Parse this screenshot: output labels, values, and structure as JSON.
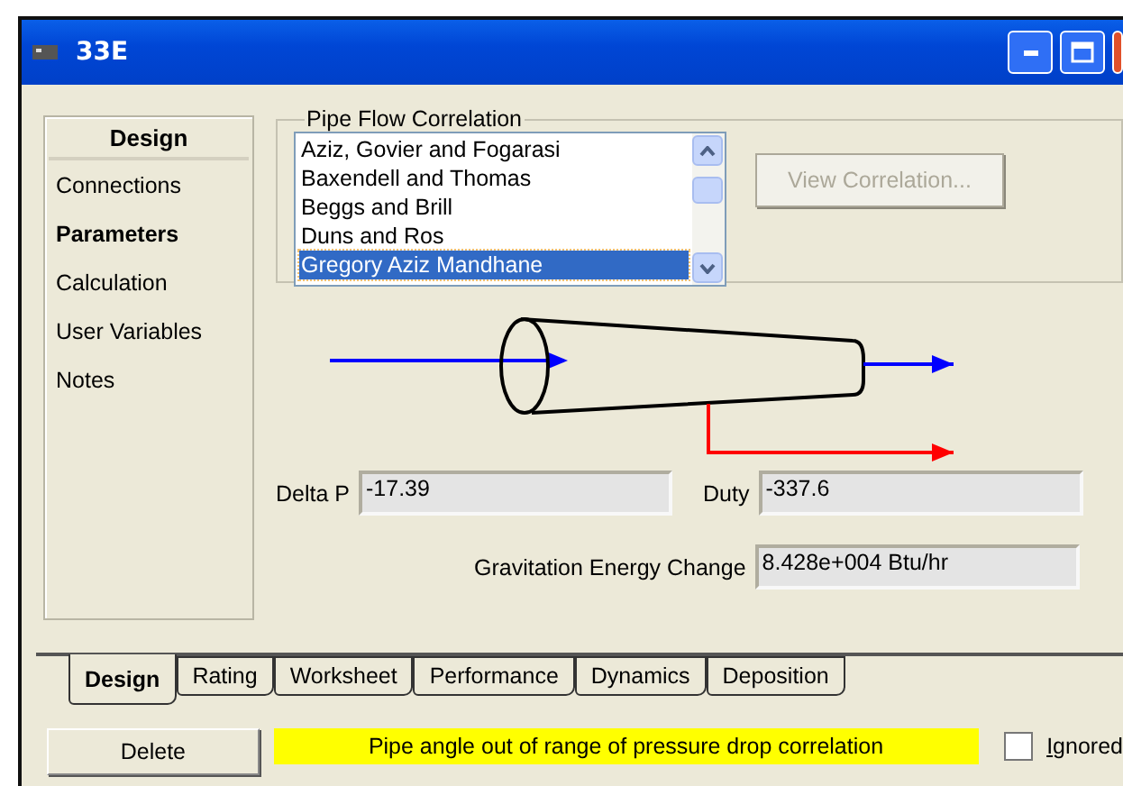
{
  "window": {
    "title": "33E"
  },
  "sidebar": {
    "header": "Design",
    "items": [
      {
        "label": "Connections",
        "selected": false
      },
      {
        "label": "Parameters",
        "selected": true
      },
      {
        "label": "Calculation",
        "selected": false
      },
      {
        "label": "User Variables",
        "selected": false
      },
      {
        "label": "Notes",
        "selected": false
      }
    ]
  },
  "correlation": {
    "title": "Pipe Flow Correlation",
    "items": [
      {
        "label": "Aziz, Govier and Fogarasi",
        "selected": false
      },
      {
        "label": "Baxendell and Thomas",
        "selected": false
      },
      {
        "label": "Beggs and Brill",
        "selected": false
      },
      {
        "label": "Duns and Ros",
        "selected": false
      },
      {
        "label": "Gregory Aziz Mandhane",
        "selected": true
      }
    ],
    "button": {
      "label": "View Correlation...",
      "disabled": true
    }
  },
  "results": {
    "delta_p": {
      "label": "Delta P",
      "value": "-17.39"
    },
    "duty": {
      "label": "Duty",
      "value": "-337.6"
    },
    "gravitation": {
      "label": "Gravitation Energy Change",
      "value": "8.428e+004 Btu/hr"
    }
  },
  "tabs": [
    {
      "label": "Design",
      "selected": true
    },
    {
      "label": "Rating",
      "selected": false
    },
    {
      "label": "Worksheet",
      "selected": false
    },
    {
      "label": "Performance",
      "selected": false
    },
    {
      "label": "Dynamics",
      "selected": false
    },
    {
      "label": "Deposition",
      "selected": false
    }
  ],
  "footer": {
    "delete": "Delete",
    "message": "Pipe angle out of range of pressure drop correlation",
    "ignored": {
      "label": "Ignored",
      "checked": false
    }
  }
}
